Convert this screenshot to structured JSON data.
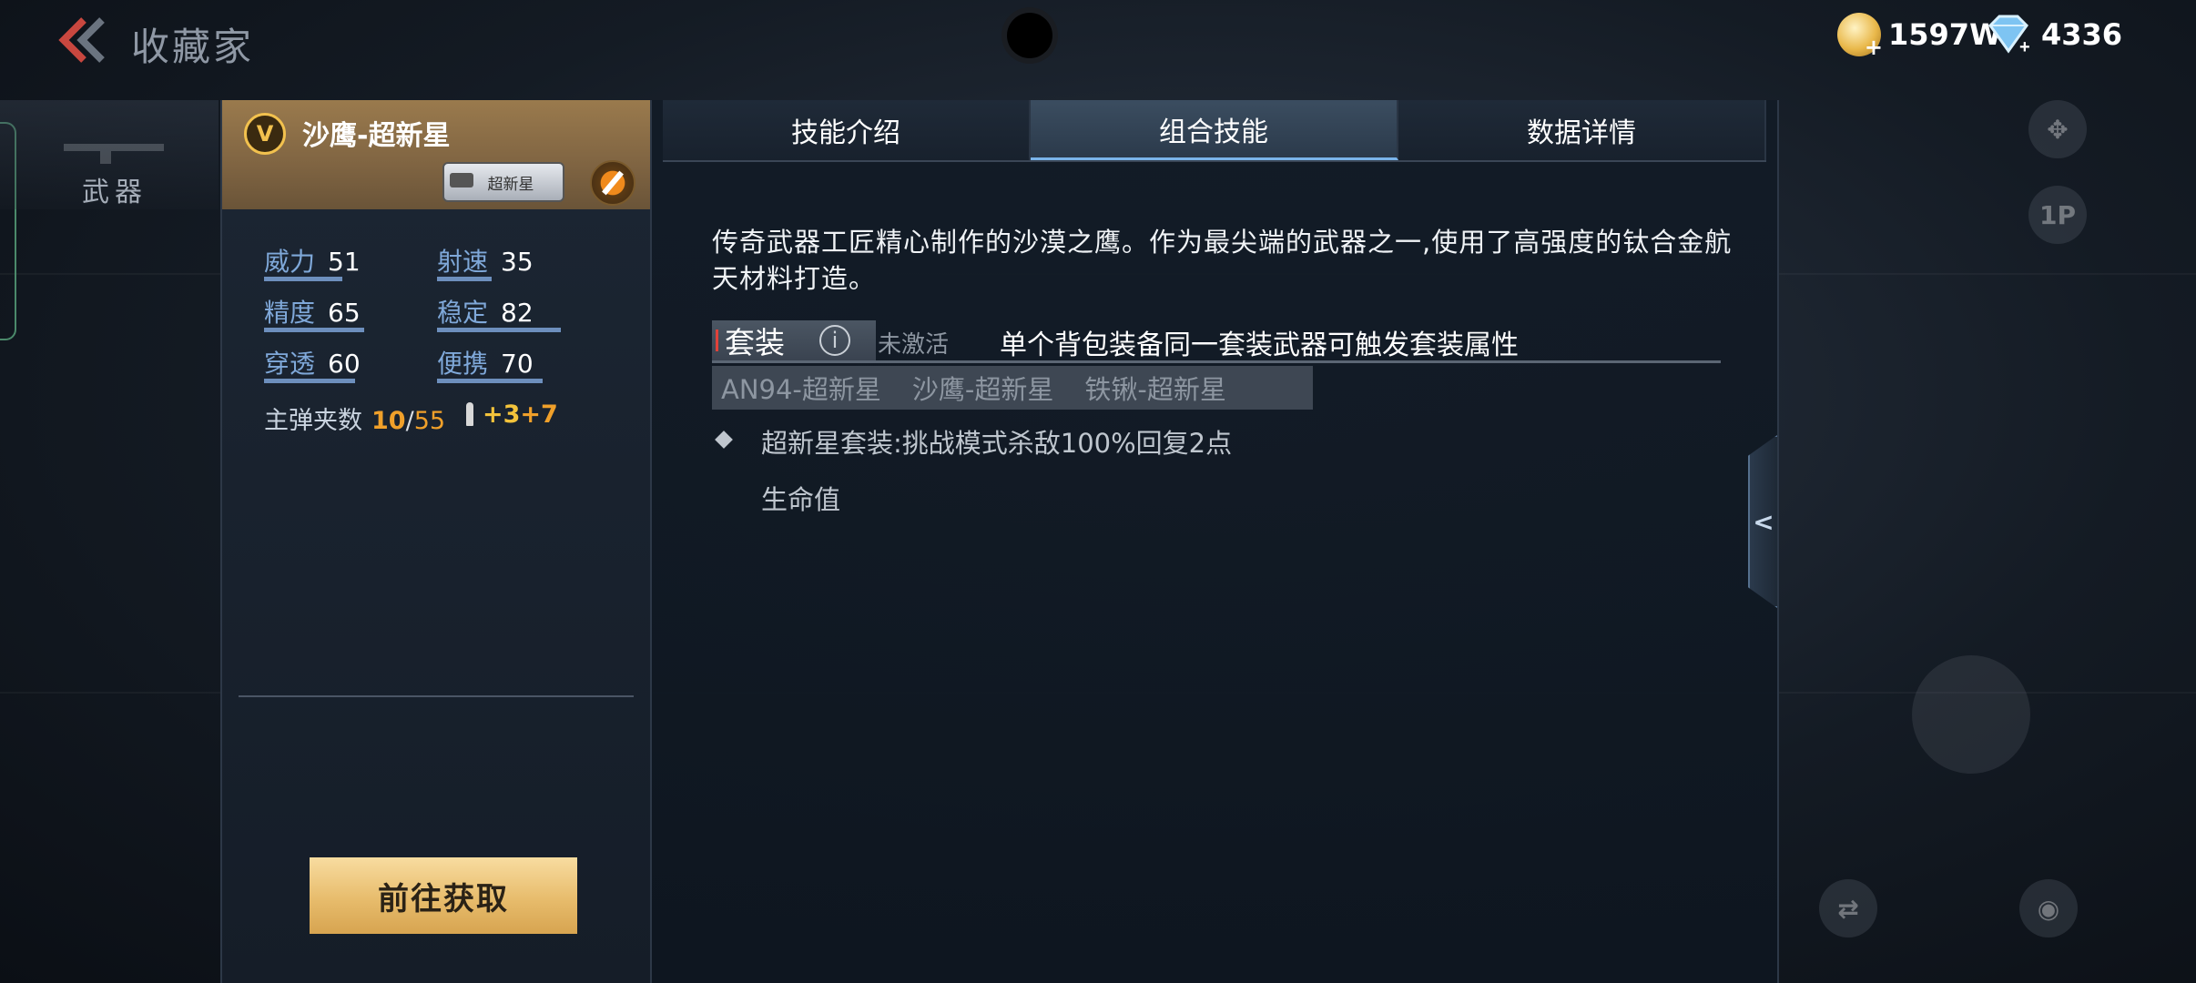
{
  "header": {
    "title": "收藏家",
    "currencies": [
      {
        "icon": "gold-coin-icon",
        "value": "1597W"
      },
      {
        "icon": "diamond-icon",
        "value": "4336"
      }
    ]
  },
  "left_nav": {
    "weapon_tab": "武器"
  },
  "weapon": {
    "name": "沙鹰-超新星",
    "rank_letter": "V",
    "tag": "超新星",
    "stats": [
      {
        "label": "威力",
        "value": "51"
      },
      {
        "label": "射速",
        "value": "35"
      },
      {
        "label": "精度",
        "value": "65"
      },
      {
        "label": "稳定",
        "value": "82"
      },
      {
        "label": "穿透",
        "value": "60"
      },
      {
        "label": "便携",
        "value": "70"
      }
    ],
    "ammo": {
      "label": "主弹夹数",
      "current": "10",
      "separator": "/",
      "max": "55",
      "bonus_a": "+3",
      "bonus_b": "+7"
    },
    "get_button": "前往获取"
  },
  "tabs": [
    {
      "label": "技能介绍",
      "active": false
    },
    {
      "label": "组合技能",
      "active": true
    },
    {
      "label": "数据详情",
      "active": false
    }
  ],
  "content": {
    "description": "传奇武器工匠精心制作的沙漠之鹰。作为最尖端的武器之一,使用了高强度的钛合金航天材料打造。",
    "set": {
      "label": "套装",
      "status": "未激活",
      "note": "单个背包装备同一套装武器可触发套装属性",
      "members": [
        "AN94-超新星",
        "沙鹰-超新星",
        "铁锹-超新星"
      ],
      "effect_line1": "超新星套装:挑战模式杀敌100%回复2点",
      "effect_line2": "生命值"
    }
  },
  "side": {
    "handle_glyph": "<",
    "mode_label": "1P"
  },
  "colors": {
    "accent": "#7ab4ea",
    "gold": "#e7bc6c",
    "orange": "#f0a02a"
  }
}
